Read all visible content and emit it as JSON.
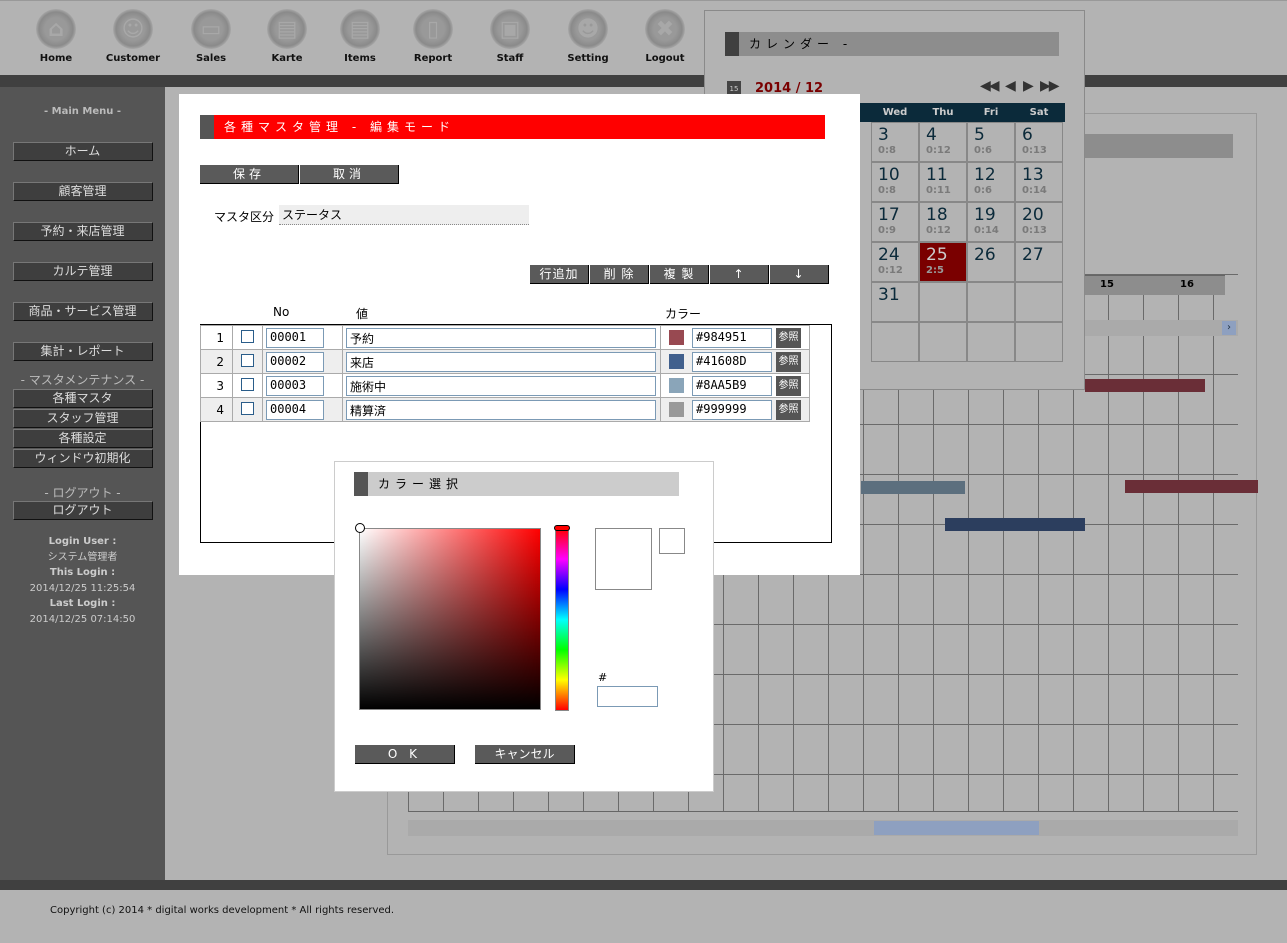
{
  "nav": [
    {
      "label": "Home",
      "icon": "home-icon",
      "glyph": "⌂"
    },
    {
      "label": "Customer",
      "icon": "customer-icon",
      "glyph": "☺"
    },
    {
      "label": "Sales",
      "icon": "folder-icon",
      "glyph": "▭"
    },
    {
      "label": "Karte",
      "icon": "document-icon",
      "glyph": "▤"
    },
    {
      "label": "Items",
      "icon": "list-document-icon",
      "glyph": "▤"
    },
    {
      "label": "Report",
      "icon": "scroll-icon",
      "glyph": "▯"
    },
    {
      "label": "Staff",
      "icon": "briefcase-icon",
      "glyph": "▣"
    },
    {
      "label": "Setting",
      "icon": "users-icon",
      "glyph": "☻"
    },
    {
      "label": "Logout",
      "icon": "logout-x-icon",
      "glyph": "✖"
    }
  ],
  "sidebar": {
    "main_heading": "- Main Menu -",
    "main_items": [
      "ホーム",
      "顧客管理",
      "予約・来店管理",
      "カルテ管理",
      "商品・サービス管理",
      "集計・レポート"
    ],
    "master_heading": "- マスタメンテナンス -",
    "master_items": [
      "各種マスタ",
      "スタッフ管理",
      "各種設定",
      "ウィンドウ初期化"
    ],
    "logout_heading": "- ログアウト -",
    "logout_item": "ログアウト",
    "login_user_label": "Login User :",
    "login_user": "システム管理者",
    "this_login_label": "This Login :",
    "this_login": "2014/12/25 11:25:54",
    "last_login_label": "Last Login :",
    "last_login": "2014/12/25 07:14:50"
  },
  "calendar": {
    "title": "カレンダー -",
    "month": "2014 / 12",
    "weekdays": [
      "Wed",
      "Thu",
      "Fri",
      "Sat"
    ],
    "weeks": [
      [
        {
          "d": "3",
          "c": "0:8"
        },
        {
          "d": "4",
          "c": "0:12"
        },
        {
          "d": "5",
          "c": "0:6"
        },
        {
          "d": "6",
          "c": "0:13"
        }
      ],
      [
        {
          "d": "10",
          "c": "0:8"
        },
        {
          "d": "11",
          "c": "0:11"
        },
        {
          "d": "12",
          "c": "0:6"
        },
        {
          "d": "13",
          "c": "0:14"
        }
      ],
      [
        {
          "d": "17",
          "c": "0:9"
        },
        {
          "d": "18",
          "c": "0:12"
        },
        {
          "d": "19",
          "c": "0:14"
        },
        {
          "d": "20",
          "c": "0:13"
        }
      ],
      [
        {
          "d": "24",
          "c": "0:12"
        },
        {
          "d": "25",
          "c": "2:5",
          "today": true
        },
        {
          "d": "26",
          "c": ""
        },
        {
          "d": "27",
          "c": ""
        }
      ],
      [
        {
          "d": "31",
          "c": ""
        },
        {
          "d": "",
          "c": ""
        },
        {
          "d": "",
          "c": ""
        },
        {
          "d": "",
          "c": ""
        }
      ],
      [
        {
          "d": "",
          "c": ""
        },
        {
          "d": "",
          "c": ""
        },
        {
          "d": "",
          "c": ""
        },
        {
          "d": "",
          "c": ""
        }
      ]
    ],
    "today_color": "#7a0000"
  },
  "schedule": {
    "hours": [
      "15",
      "16"
    ]
  },
  "master_dialog": {
    "title": "各種マスタ管理 - 編集モード",
    "title_color": "#ff0000",
    "save": "保存",
    "cancel": "取消",
    "category_label": "マスタ区分",
    "category_value": "ステータス",
    "actions": [
      "行追加",
      "削 除",
      "複 製",
      "↑",
      "↓"
    ],
    "col_no": "No",
    "col_value": "値",
    "col_color": "カラー",
    "ref_label": "参照",
    "rows": [
      {
        "idx": "1",
        "no": "00001",
        "value": "予約",
        "color": "#984951"
      },
      {
        "idx": "2",
        "no": "00002",
        "value": "来店",
        "color": "#41608D"
      },
      {
        "idx": "3",
        "no": "00003",
        "value": "施術中",
        "color": "#8AA5B9"
      },
      {
        "idx": "4",
        "no": "00004",
        "value": "精算済",
        "color": "#999999"
      }
    ]
  },
  "color_dialog": {
    "title": "カラー選択",
    "hash_label": "#",
    "hex_value": "",
    "ok": "O K",
    "cancel": "キャンセル"
  },
  "footer": "Copyright (c) 2014 * digital works development * All rights reserved."
}
